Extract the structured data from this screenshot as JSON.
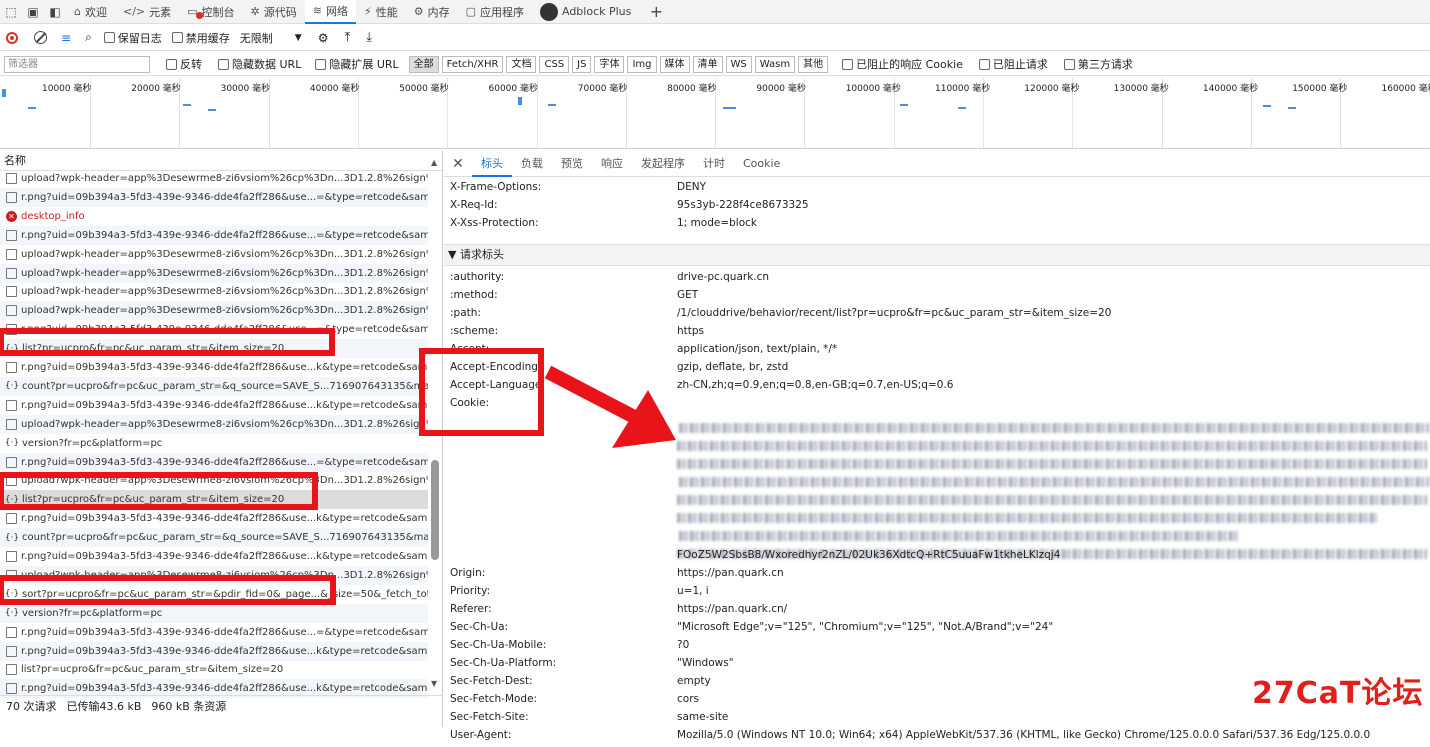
{
  "tabbar": {
    "tabs": [
      {
        "label": "欢迎",
        "icon": "home-icon",
        "active": false
      },
      {
        "label": "元素",
        "icon": "code-icon",
        "active": false
      },
      {
        "label": "控制台",
        "icon": "console-icon",
        "active": false
      },
      {
        "label": "源代码",
        "icon": "bug-icon",
        "active": false
      },
      {
        "label": "网络",
        "icon": "wifi-icon",
        "active": true
      },
      {
        "label": "性能",
        "icon": "performance-icon",
        "active": false
      },
      {
        "label": "内存",
        "icon": "memory-icon",
        "active": false
      },
      {
        "label": "应用程序",
        "icon": "application-icon",
        "active": false
      },
      {
        "label": "Adblock Plus",
        "icon": "adblock-icon",
        "active": false
      }
    ],
    "add_label": "+"
  },
  "toolbar": {
    "preserve_log": "保留日志",
    "disable_cache": "禁用缓存",
    "throttle": "无限制"
  },
  "filterbar": {
    "placeholder": "筛选器",
    "invert": "反转",
    "hide_data_url": "隐藏数据 URL",
    "hide_ext_url": "隐藏扩展 URL",
    "types": [
      "全部",
      "Fetch/XHR",
      "文档",
      "CSS",
      "JS",
      "字体",
      "Img",
      "媒体",
      "清单",
      "WS",
      "Wasm",
      "其他"
    ],
    "blocked_cookies": "已阻止的响应 Cookie",
    "blocked_requests": "已阻止请求",
    "third_party": "第三方请求"
  },
  "overview": {
    "ticks": [
      "10000 毫秒",
      "20000 毫秒",
      "30000 毫秒",
      "40000 毫秒",
      "50000 毫秒",
      "60000 毫秒",
      "70000 毫秒",
      "80000 毫秒",
      "90000 毫秒",
      "100000 毫秒",
      "110000 毫秒",
      "120000 毫秒",
      "130000 毫秒",
      "140000 毫秒",
      "150000 毫秒",
      "160000 毫秒"
    ]
  },
  "requests": {
    "header": "名称",
    "rows": [
      {
        "name": "upload?wpk-header=app%3Desewrme8-zi6vsiom%26cp%3Dn...3D1.2.8%26sign%3...",
        "type": "doc"
      },
      {
        "name": "r.png?uid=09b394a3-5fd3-439e-9346-dde4fa2ff286&use...=&type=retcode&samp...",
        "type": "img"
      },
      {
        "name": "desktop_info",
        "type": "error"
      },
      {
        "name": "r.png?uid=09b394a3-5fd3-439e-9346-dde4fa2ff286&use...=&type=retcode&samp...",
        "type": "img"
      },
      {
        "name": "upload?wpk-header=app%3Desewrme8-zi6vsiom%26cp%3Dn...3D1.2.8%26sign%3...",
        "type": "doc"
      },
      {
        "name": "upload?wpk-header=app%3Desewrme8-zi6vsiom%26cp%3Dn...3D1.2.8%26sign%3...",
        "type": "doc"
      },
      {
        "name": "upload?wpk-header=app%3Desewrme8-zi6vsiom%26cp%3Dn...3D1.2.8%26sign%3...",
        "type": "doc"
      },
      {
        "name": "upload?wpk-header=app%3Desewrme8-zi6vsiom%26cp%3Dn...3D1.2.8%26sign%3...",
        "type": "doc"
      },
      {
        "name": "r.png?uid=09b394a3-5fd3-439e-9346-dde4fa2ff286&use...=&type=retcode&samp...",
        "type": "img"
      },
      {
        "name": "list?pr=ucpro&fr=pc&uc_param_str=&item_size=20",
        "type": "xhr"
      },
      {
        "name": "r.png?uid=09b394a3-5fd3-439e-9346-dde4fa2ff286&use...k&type=retcode&sampl...",
        "type": "img"
      },
      {
        "name": "count?pr=ucpro&fr=pc&uc_param_str=&q_source=SAVE_S...716907643135&max_t...",
        "type": "xhr"
      },
      {
        "name": "r.png?uid=09b394a3-5fd3-439e-9346-dde4fa2ff286&use...k&type=retcode&sampl...",
        "type": "img"
      },
      {
        "name": "upload?wpk-header=app%3Desewrme8-zi6vsiom%26cp%3Dn...3D1.2.8%26sign%3...",
        "type": "doc"
      },
      {
        "name": "version?fr=pc&platform=pc",
        "type": "xhr"
      },
      {
        "name": "r.png?uid=09b394a3-5fd3-439e-9346-dde4fa2ff286&use...=&type=retcode&samp...",
        "type": "img"
      },
      {
        "name": "upload?wpk-header=app%3Desewrme8-zi6vsiom%26cp%3Dn...3D1.2.8%26sign%3...",
        "type": "doc"
      },
      {
        "name": "list?pr=ucpro&fr=pc&uc_param_str=&item_size=20",
        "type": "xhr"
      },
      {
        "name": "r.png?uid=09b394a3-5fd3-439e-9346-dde4fa2ff286&use...k&type=retcode&sampl...",
        "type": "img"
      },
      {
        "name": "count?pr=ucpro&fr=pc&uc_param_str=&q_source=SAVE_S...716907643135&max_t...",
        "type": "xhr"
      },
      {
        "name": "r.png?uid=09b394a3-5fd3-439e-9346-dde4fa2ff286&use...k&type=retcode&sampl...",
        "type": "img"
      },
      {
        "name": "upload?wpk-header=app%3Desewrme8-zi6vsiom%26cp%3Dn...3D1.2.8%26sign%3...",
        "type": "doc"
      },
      {
        "name": "sort?pr=ucpro&fr=pc&uc_param_str=&pdir_fid=0&_page...&_size=50&_fetch_total...",
        "type": "xhr"
      },
      {
        "name": "version?fr=pc&platform=pc",
        "type": "xhr"
      },
      {
        "name": "r.png?uid=09b394a3-5fd3-439e-9346-dde4fa2ff286&use...=&type=retcode&samp...",
        "type": "img"
      },
      {
        "name": "r.png?uid=09b394a3-5fd3-439e-9346-dde4fa2ff286&use...k&type=retcode&sampl...",
        "type": "img"
      },
      {
        "name": "list?pr=ucpro&fr=pc&uc_param_str=&item_size=20",
        "type": "doc"
      },
      {
        "name": "r.png?uid=09b394a3-5fd3-439e-9346-dde4fa2ff286&use...k&type=retcode&sampi...",
        "type": "img"
      }
    ]
  },
  "status": {
    "requests": "70 次请求",
    "transferred": "已传输43.6 kB",
    "resources": "960 kB 条资源"
  },
  "detail": {
    "tabs": [
      "标头",
      "负载",
      "预览",
      "响应",
      "发起程序",
      "计时",
      "Cookie"
    ],
    "response_headers": [
      {
        "name": "X-Frame-Options:",
        "value": "DENY"
      },
      {
        "name": "X-Req-Id:",
        "value": "95s3yb-228f4ce8673325"
      },
      {
        "name": "X-Xss-Protection:",
        "value": "1; mode=block"
      }
    ],
    "request_section": "▼ 请求标头",
    "request_headers": [
      {
        "name": ":authority:",
        "value": "drive-pc.quark.cn"
      },
      {
        "name": ":method:",
        "value": "GET"
      },
      {
        "name": ":path:",
        "value": "/1/clouddrive/behavior/recent/list?pr=ucpro&fr=pc&uc_param_str=&item_size=20"
      },
      {
        "name": ":scheme:",
        "value": "https"
      },
      {
        "name": "Accept:",
        "value": "application/json, text/plain, */*"
      },
      {
        "name": "Accept-Encoding:",
        "value": "gzip, deflate, br, zstd"
      },
      {
        "name": "Accept-Language:",
        "value": "zh-CN,zh;q=0.9,en;q=0.8,en-GB;q=0.7,en-US;q=0.6"
      },
      {
        "name": "Cookie:",
        "value": ""
      }
    ],
    "cookie_tail": "FOoZ5W2SbsB8/Wxoredhyr2nZL/02Uk36XdtcQ+RtC5uuaFw1tkheLKlzqj4",
    "request_headers2": [
      {
        "name": "Origin:",
        "value": "https://pan.quark.cn"
      },
      {
        "name": "Priority:",
        "value": "u=1, i"
      },
      {
        "name": "Referer:",
        "value": "https://pan.quark.cn/"
      },
      {
        "name": "Sec-Ch-Ua:",
        "value": "\"Microsoft Edge\";v=\"125\", \"Chromium\";v=\"125\", \"Not.A/Brand\";v=\"24\""
      },
      {
        "name": "Sec-Ch-Ua-Mobile:",
        "value": "?0"
      },
      {
        "name": "Sec-Ch-Ua-Platform:",
        "value": "\"Windows\""
      },
      {
        "name": "Sec-Fetch-Dest:",
        "value": "empty"
      },
      {
        "name": "Sec-Fetch-Mode:",
        "value": "cors"
      },
      {
        "name": "Sec-Fetch-Site:",
        "value": "same-site"
      },
      {
        "name": "User-Agent:",
        "value": "Mozilla/5.0 (Windows NT 10.0; Win64; x64) AppleWebKit/537.36 (KHTML, like Gecko) Chrome/125.0.0.0 Safari/537.36 Edg/125.0.0.0"
      }
    ]
  },
  "watermark": "27CaT论坛",
  "colors": {
    "accent": "#1a73e8",
    "highlight": "#e8141a"
  }
}
